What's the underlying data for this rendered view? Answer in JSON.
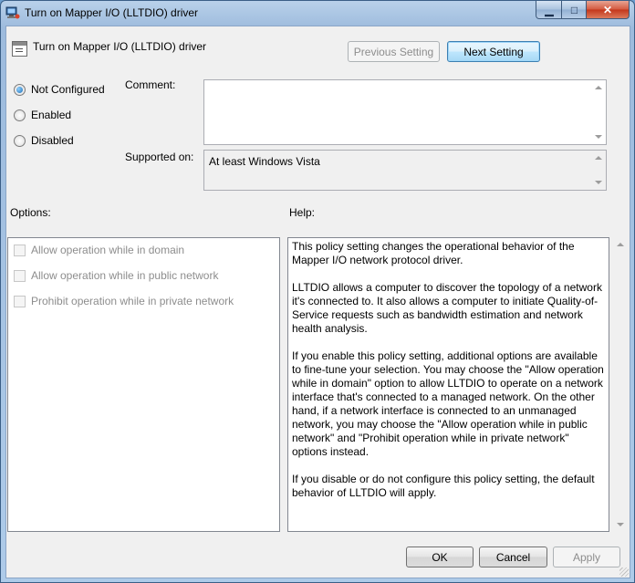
{
  "window": {
    "title": "Turn on Mapper I/O (LLTDIO) driver",
    "caption": {
      "minimize": "▁",
      "maximize": "□",
      "close": "✕"
    }
  },
  "header": {
    "policy_name": "Turn on Mapper I/O (LLTDIO) driver",
    "previous_setting": "Previous Setting",
    "next_setting": "Next Setting"
  },
  "state": {
    "options": [
      {
        "label": "Not Configured",
        "checked": true
      },
      {
        "label": "Enabled",
        "checked": false
      },
      {
        "label": "Disabled",
        "checked": false
      }
    ]
  },
  "comment": {
    "label": "Comment:",
    "value": ""
  },
  "supported": {
    "label": "Supported on:",
    "value": "At least Windows Vista"
  },
  "options_panel": {
    "label": "Options:",
    "items": [
      "Allow operation while in domain",
      "Allow operation while in public network",
      "Prohibit operation while in private network"
    ]
  },
  "help_panel": {
    "label": "Help:",
    "paragraphs": [
      "This policy setting changes the operational behavior of the Mapper I/O network protocol driver.",
      "LLTDIO allows a computer to discover the topology of a network it's connected to. It also allows a computer to initiate Quality-of-Service requests such as bandwidth estimation and network health analysis.",
      "If you enable this policy setting, additional options are available to fine-tune your selection. You may choose the \"Allow operation while in domain\" option to allow LLTDIO to operate on a network interface that's connected to a managed network. On the other hand, if a network interface is connected to an unmanaged network, you may choose the \"Allow operation while in public network\" and \"Prohibit operation while in private network\" options instead.",
      "If you disable or do not configure this policy setting, the default behavior of LLTDIO will apply."
    ]
  },
  "footer": {
    "ok": "OK",
    "cancel": "Cancel",
    "apply": "Apply"
  },
  "icons": {
    "app": "network-policy-icon",
    "policy": "policy-setting-icon"
  }
}
